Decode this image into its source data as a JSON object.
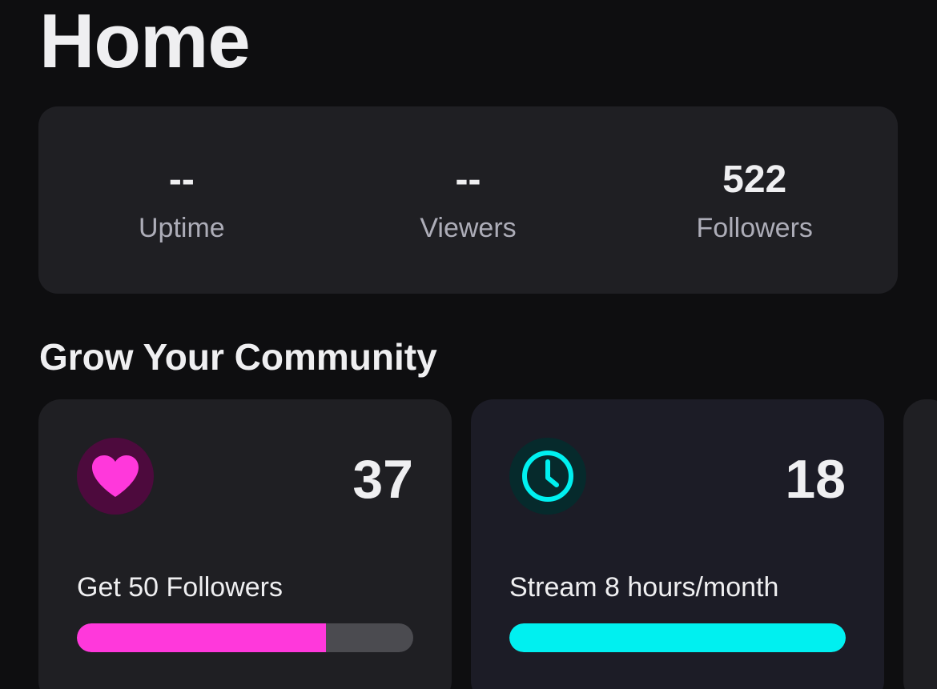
{
  "page": {
    "title": "Home"
  },
  "stats": [
    {
      "value": "--",
      "label": "Uptime"
    },
    {
      "value": "--",
      "label": "Viewers"
    },
    {
      "value": "522",
      "label": "Followers"
    }
  ],
  "section": {
    "title": "Grow Your Community"
  },
  "goals": [
    {
      "icon": "heart-icon",
      "count": "37",
      "label": "Get 50 Followers",
      "progress": 0.74,
      "accent": "#ff38db",
      "icon_bg": "#4d0a3d"
    },
    {
      "icon": "clock-icon",
      "count": "18",
      "label": "Stream 8 hours/month",
      "progress": 1.0,
      "accent": "#00f0f0",
      "icon_bg": "#062a2c"
    }
  ],
  "colors": {
    "background": "#0e0e10",
    "card": "#1f1f23",
    "track": "#4b4b50",
    "muted_text": "#adadb8"
  }
}
